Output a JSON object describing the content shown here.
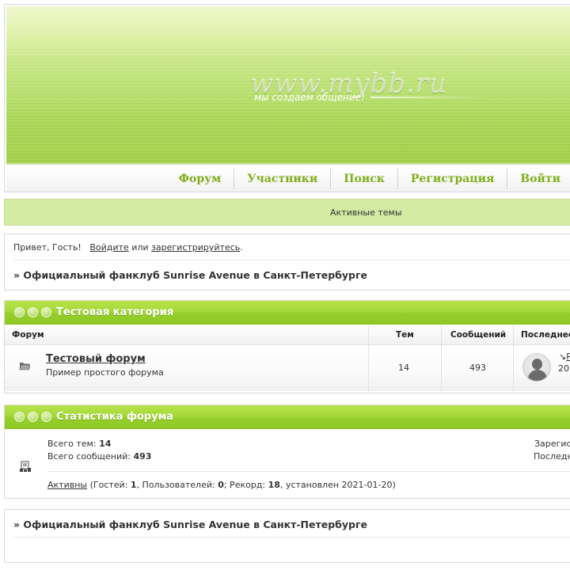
{
  "header": {
    "logo_text": "www.mybb.ru",
    "slogan": "мы создаем общение!"
  },
  "nav": {
    "items": [
      "Форум",
      "Участники",
      "Поиск",
      "Регистрация",
      "Войти"
    ]
  },
  "announce": {
    "text": "Активные темы"
  },
  "guest": {
    "greeting": "Привет, Гость!",
    "login_link": "Войдите",
    "or_text": "или",
    "register_link": "зарегистрируйтесь",
    "period": "."
  },
  "breadcrumb": "» Официальный фанклуб Sunrise Avenue в Санкт-Петербурге",
  "category": {
    "title": "Тестовая категория",
    "columns": {
      "forum": "Форум",
      "topics": "Тем",
      "posts": "Сообщений",
      "last": "Последнее"
    },
    "forums": [
      {
        "name": "Тестовый форум",
        "description": "Пример простого форума",
        "topics": "14",
        "posts": "493",
        "last_arrow": "↘",
        "last_link": "Р",
        "last_date": "20"
      }
    ]
  },
  "stats": {
    "title": "Статистика форума",
    "topics_label": "Всего тем:",
    "topics_value": "14",
    "posts_label": "Всего сообщений:",
    "posts_value": "493",
    "right_1": "Зарегис",
    "right_2": "Последн",
    "online_link": "Активны",
    "online_prefix": "(Гостей:",
    "guests": "1",
    "users_label": ", Пользователей:",
    "users": "0",
    "record_label": "; Рекорд:",
    "record": "18",
    "record_date": ", установлен 2021-01-20)"
  },
  "colors": {
    "accent_green": "#7fae1b",
    "header_green": "#96cf2b",
    "announce_bg": "#d3eaa3"
  }
}
